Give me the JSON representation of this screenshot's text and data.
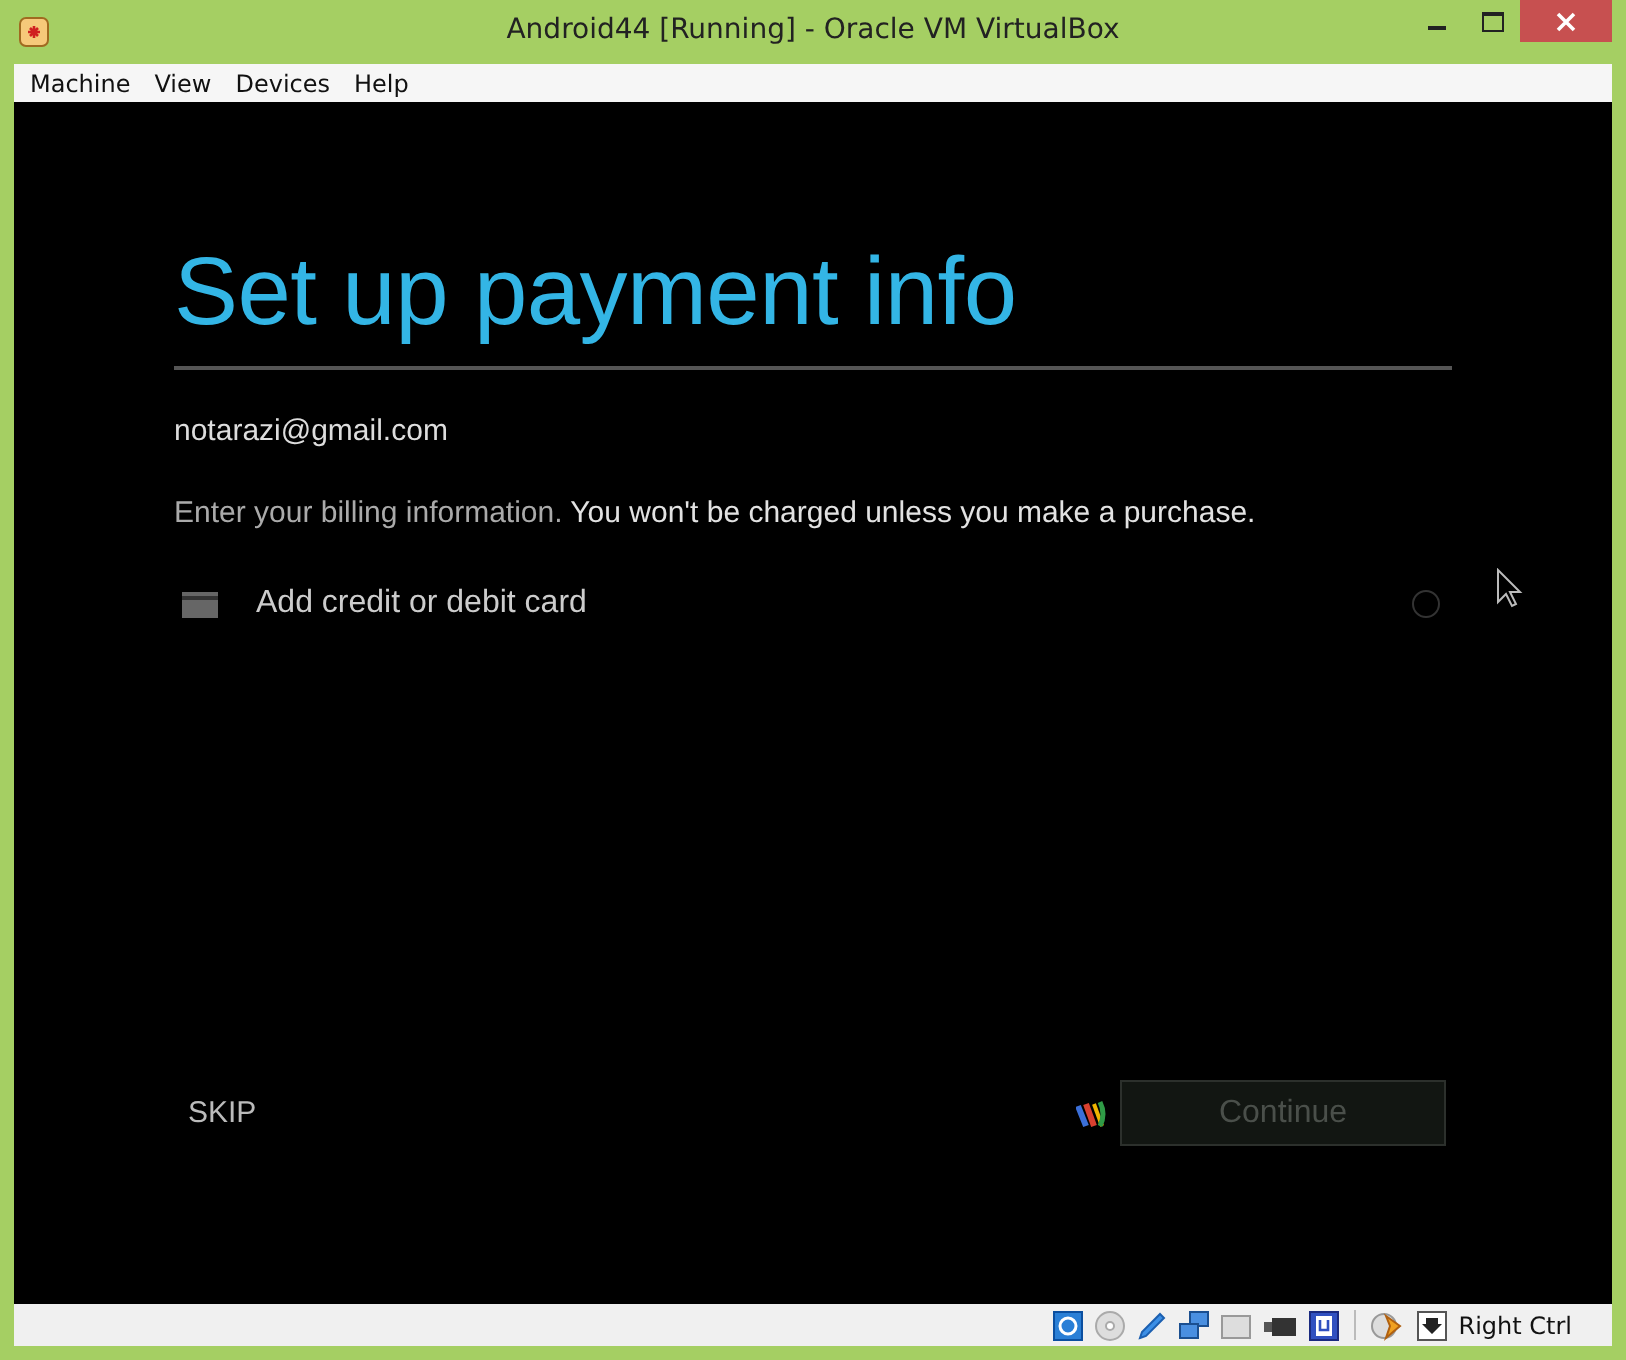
{
  "window": {
    "title": "Android44 [Running] - Oracle VM VirtualBox"
  },
  "menu": [
    "Machine",
    "View",
    "Devices",
    "Help"
  ],
  "screen": {
    "heading": "Set up payment info",
    "account": "notarazi@gmail.com",
    "billing_intro": "Enter your billing information.",
    "billing_note": "You won't be charged unless you make a purchase.",
    "payment_options": [
      {
        "label": "Add credit or debit card",
        "selected": false
      }
    ],
    "skip": "SKIP",
    "continue": {
      "label": "Continue",
      "disabled": true
    }
  },
  "status_bar": {
    "host_key": "Right Ctrl"
  }
}
